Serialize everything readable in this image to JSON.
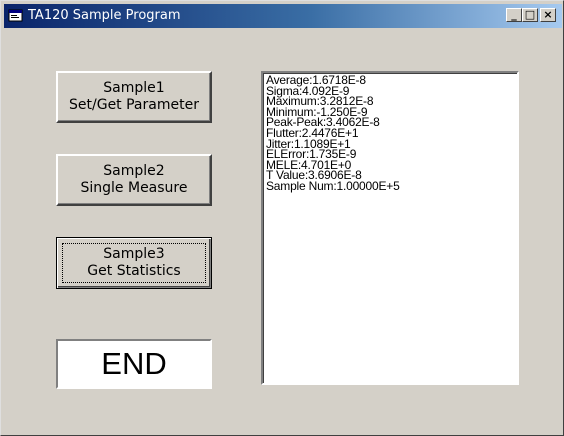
{
  "window": {
    "title": "TA120 Sample Program",
    "minimize_glyph": "_",
    "maximize_glyph": "□",
    "close_glyph": "×"
  },
  "buttons": {
    "sample1": {
      "line1": "Sample1",
      "line2": "Set/Get Parameter"
    },
    "sample2": {
      "line1": "Sample2",
      "line2": "Single Measure"
    },
    "sample3": {
      "line1": "Sample3",
      "line2": "Get Statistics"
    }
  },
  "end_label": "END",
  "results": [
    "Average:1.6718E-8",
    "Sigma:4.092E-9",
    "Maximum:3.2812E-8",
    "Minimum:-1.250E-9",
    "Peak-Peak:3.4062E-8",
    "Flutter:2.4476E+1",
    "Jitter:1.1089E+1",
    "ELError:1.735E-9",
    "MELE:4.701E+0",
    "T Value:3.6906E-8",
    "Sample Num:1.00000E+5"
  ],
  "colors": {
    "titlebar_start": "#0a246a",
    "titlebar_end": "#a6caf0",
    "face": "#d4d0c8"
  }
}
